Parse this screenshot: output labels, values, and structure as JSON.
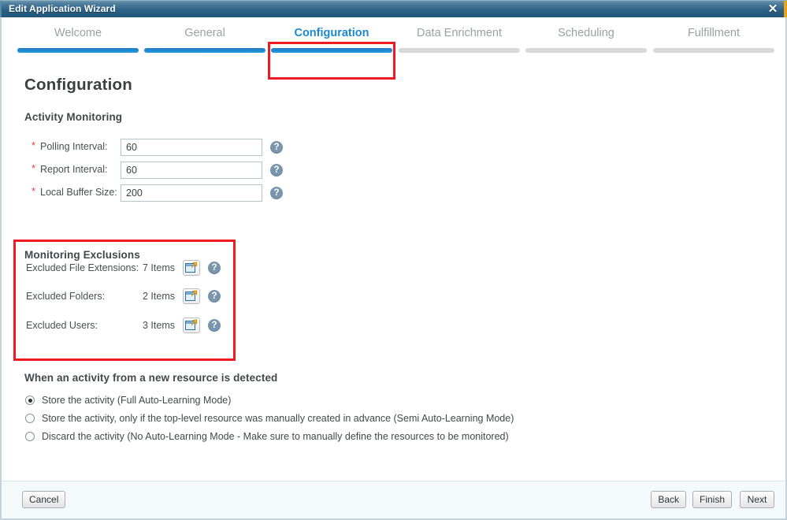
{
  "window": {
    "title": "Edit Application Wizard",
    "close_icon": "close-icon",
    "close_glyph": "✕"
  },
  "wizard_steps": [
    {
      "label": "Welcome",
      "state": "done"
    },
    {
      "label": "General",
      "state": "done"
    },
    {
      "label": "Configuration",
      "state": "active"
    },
    {
      "label": "Data Enrichment",
      "state": "todo"
    },
    {
      "label": "Scheduling",
      "state": "todo"
    },
    {
      "label": "Fulfillment",
      "state": "todo"
    }
  ],
  "page": {
    "title": "Configuration"
  },
  "activity_monitoring": {
    "section_title": "Activity Monitoring",
    "required_marker": "*",
    "help_glyph": "?",
    "fields": [
      {
        "label": "Polling Interval:",
        "value": "60",
        "required": true
      },
      {
        "label": "Report Interval:",
        "value": "60",
        "required": true
      },
      {
        "label": "Local Buffer Size:",
        "value": "200",
        "required": true
      }
    ]
  },
  "monitoring_exclusions": {
    "section_title": "Monitoring Exclusions",
    "help_glyph": "?",
    "open_list_icon": "open-list-window-icon",
    "rows": [
      {
        "label": "Excluded File Extensions:",
        "count": "7 Items"
      },
      {
        "label": "Excluded Folders:",
        "count": "2 Items"
      },
      {
        "label": "Excluded Users:",
        "count": "3 Items"
      }
    ]
  },
  "new_resource_policy": {
    "section_title": "When an activity from a new resource is detected",
    "options": [
      {
        "label": "Store the activity (Full Auto-Learning Mode)",
        "selected": true
      },
      {
        "label": "Store the activity, only if the top-level resource was manually created in advance (Semi Auto-Learning Mode)",
        "selected": false
      },
      {
        "label": "Discard the activity (No Auto-Learning Mode - Make sure to manually define the resources to be monitored)",
        "selected": false
      }
    ]
  },
  "footer": {
    "cancel_label": "Cancel",
    "back_label": "Back",
    "finish_label": "Finish",
    "next_label": "Next"
  },
  "annotations": {
    "highlight_color": "#ee1c22",
    "boxes": [
      {
        "name": "configuration-tab-highlight"
      },
      {
        "name": "monitoring-exclusions-highlight"
      }
    ]
  },
  "colors": {
    "titlebar_start": "#6d94ae",
    "titlebar_end": "#1f5578",
    "active_tab_text": "#1b88d0",
    "step_bar_active": "#1f86cd",
    "step_bar_inactive": "#d6d8da",
    "required_star": "#ef3b3b",
    "help_icon_bg": "#7a96ac",
    "accent_edge": "#e8a317"
  }
}
